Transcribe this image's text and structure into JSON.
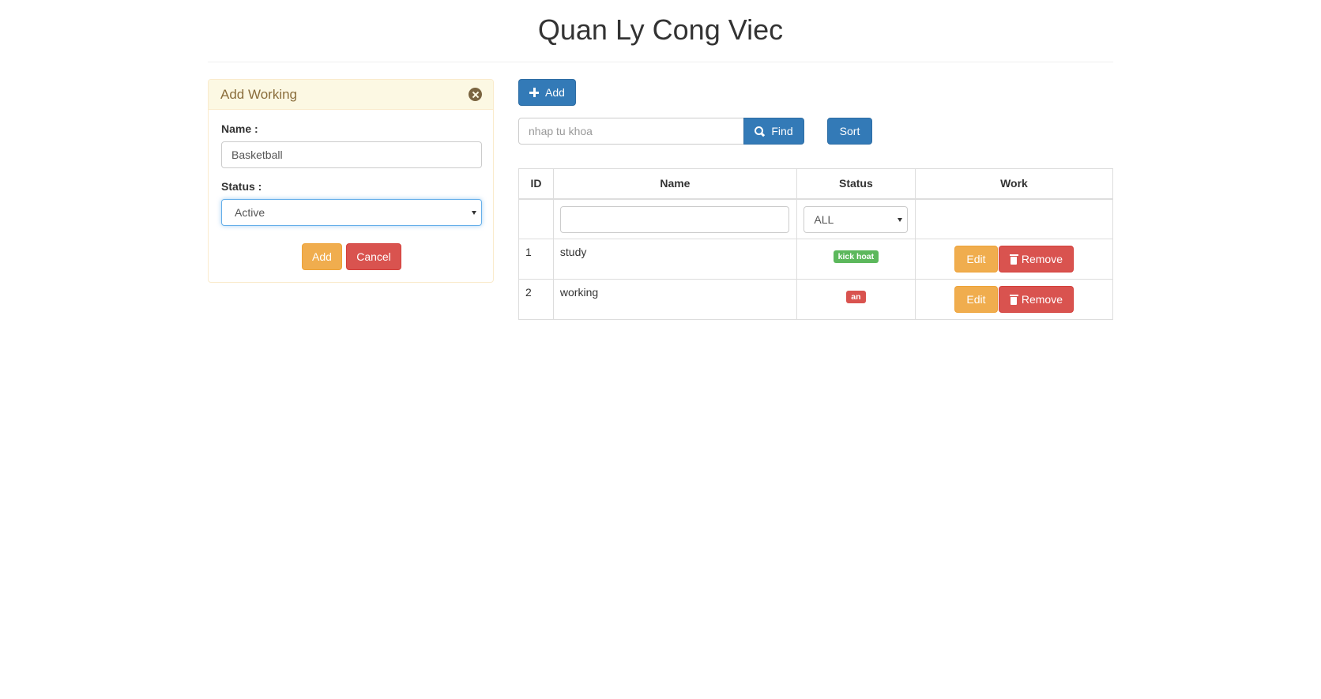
{
  "page": {
    "title": "Quan Ly Cong Viec"
  },
  "form": {
    "title": "Add Working",
    "name_label": "Name :",
    "name_value": "Basketball",
    "status_label": "Status :",
    "status_value": "Active",
    "add_label": "Add",
    "cancel_label": "Cancel"
  },
  "toolbar": {
    "add_label": "Add",
    "search_placeholder": "nhap tu khoa",
    "find_label": "Find",
    "sort_label": "Sort"
  },
  "table": {
    "headers": {
      "id": "ID",
      "name": "Name",
      "status": "Status",
      "work": "Work"
    },
    "filter": {
      "status_value": "ALL"
    },
    "rows": [
      {
        "id": "1",
        "name": "study",
        "status": "kick hoat",
        "status_color": "#5cb85c",
        "edit": "Edit",
        "remove": "Remove"
      },
      {
        "id": "2",
        "name": "working",
        "status": "an",
        "status_color": "#d9534f",
        "edit": "Edit",
        "remove": "Remove"
      }
    ]
  },
  "colors": {
    "primary": "#337ab7",
    "warning": "#f0ad4e",
    "danger": "#d9534f",
    "success": "#5cb85c",
    "panel_heading_bg": "#fcf8e3",
    "panel_heading_text": "#8a6d3b"
  },
  "icons": [
    "close-icon",
    "plus-icon",
    "search-icon",
    "trash-icon",
    "chevron-down-icon"
  ]
}
